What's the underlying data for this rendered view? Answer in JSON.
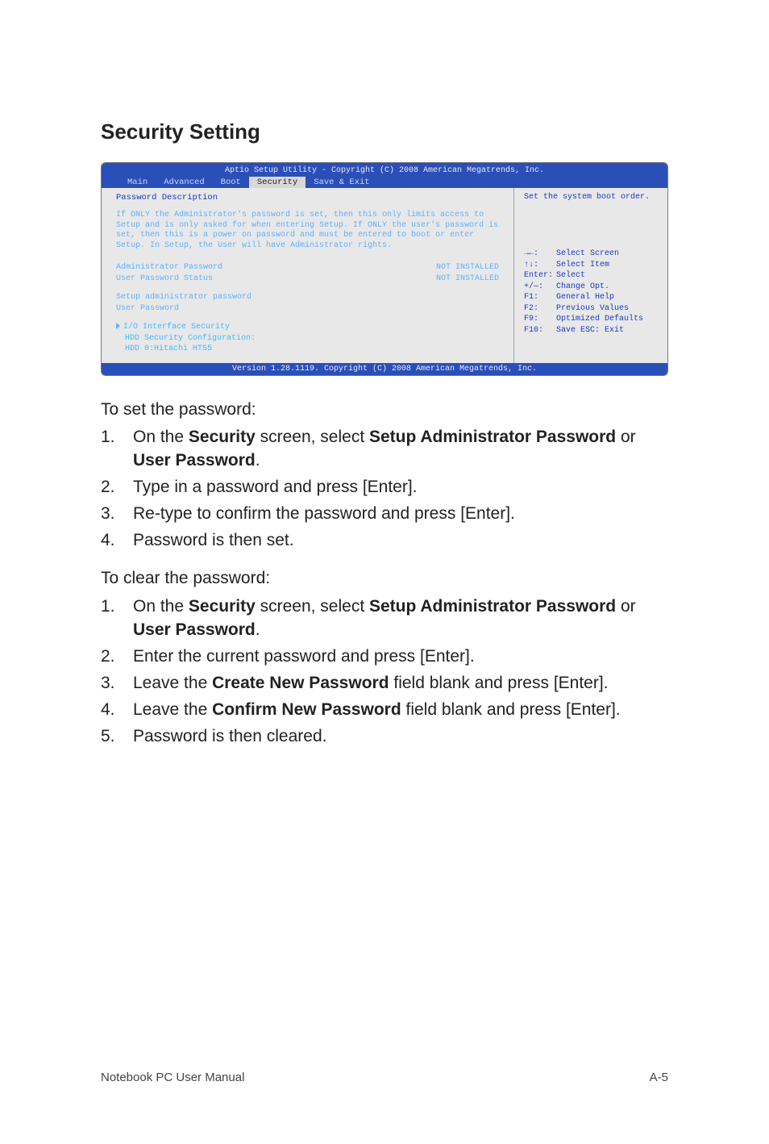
{
  "title": "Security Setting",
  "bios": {
    "header_title": "Aptio Setup Utility - Copyright (C) 2008 American Megatrends, Inc.",
    "tabs": [
      "Main",
      "Advanced",
      "Boot",
      "Security",
      "Save & Exit"
    ],
    "active_tab": "Security",
    "password_description_title": "Password Description",
    "password_description_body": "If ONLY the Administrator's password is set, then this only limits access to Setup and is only asked for when entering Setup. If ONLY the user's password is set, then this is a power on password and must be entered to boot or enter Setup. In Setup, the User will have Administrator rights.",
    "rows": [
      {
        "label": "Administrator Password",
        "value": "NOT INSTALLED"
      },
      {
        "label": "User Password Status",
        "value": "NOT INSTALLED"
      }
    ],
    "setup_admin": "Setup administrator password",
    "user_password": "User Password",
    "io_security": "I/O Interface Security",
    "hdd_sec_cfg": "HDD Security Configuration:",
    "hdd_item": "HDD 0:Hitachi HTS5",
    "right_top": "Set the system boot order.",
    "help": [
      {
        "k": "→←:",
        "v": "Select Screen"
      },
      {
        "k": "↑↓:",
        "v": "Select Item"
      },
      {
        "k": "Enter:",
        "v": "Select"
      },
      {
        "k": "+/—:",
        "v": "Change Opt."
      },
      {
        "k": "F1:",
        "v": "General Help"
      },
      {
        "k": "F2:",
        "v": "Previous Values"
      },
      {
        "k": "F9:",
        "v": "Optimized Defaults"
      },
      {
        "k": "F10:",
        "v": "Save    ESC: Exit"
      }
    ],
    "footer": "Version 1.28.1119. Copyright (C) 2008 American Megatrends, Inc."
  },
  "set_password": {
    "intro": "To set the password:",
    "steps": {
      "s1a": "On the ",
      "s1b": "Security",
      "s1c": " screen, select ",
      "s1d": "Setup Administrator Password",
      "s1e": " or ",
      "s1f": "User Password",
      "s1g": ".",
      "s2": "Type in a password and press [Enter].",
      "s3": "Re-type to confirm the password and press [Enter].",
      "s4": "Password is then set."
    }
  },
  "clear_password": {
    "intro": "To clear the password:",
    "steps": {
      "s1a": "On the ",
      "s1b": "Security",
      "s1c": " screen, select ",
      "s1d": "Setup Administrator Password",
      "s1e": " or ",
      "s1f": "User Password",
      "s1g": ".",
      "s2": "Enter the current password and press [Enter].",
      "s3a": "Leave the ",
      "s3b": "Create New Password",
      "s3c": " field blank and press [Enter].",
      "s4a": "Leave the ",
      "s4b": "Confirm New Password",
      "s4c": " field blank and press [Enter].",
      "s5": "Password is then cleared."
    }
  },
  "footer": {
    "left": "Notebook PC User Manual",
    "right": "A-5"
  },
  "nums": [
    "1.",
    "2.",
    "3.",
    "4.",
    "5."
  ]
}
